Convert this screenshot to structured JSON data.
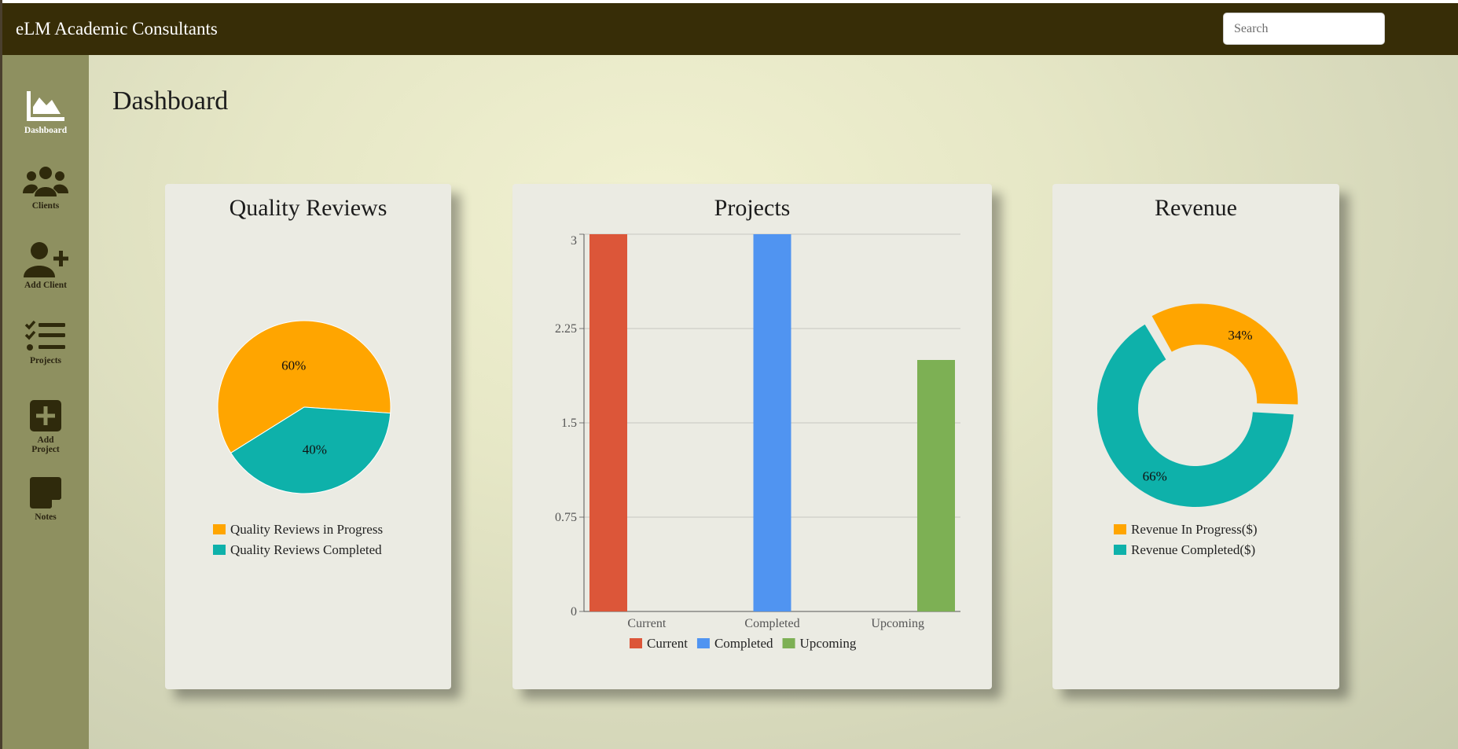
{
  "app": {
    "title": "eLM Academic Consultants"
  },
  "search": {
    "placeholder": "Search",
    "value": ""
  },
  "sidebar": {
    "items": [
      {
        "label": "Dashboard",
        "icon": "chart-area-icon",
        "active": true
      },
      {
        "label": "Clients",
        "icon": "users-icon",
        "active": false
      },
      {
        "label": "Add Client",
        "icon": "user-plus-icon",
        "active": false
      },
      {
        "label": "Projects",
        "icon": "task-list-icon",
        "active": false
      },
      {
        "label": "Add Project",
        "icon": "plus-square-icon",
        "active": false
      },
      {
        "label": "Notes",
        "icon": "sticky-note-icon",
        "active": false
      }
    ]
  },
  "page": {
    "title": "Dashboard"
  },
  "colors": {
    "header": "#372d07",
    "sidebar": "#8e9060",
    "orange": "#ffa500",
    "teal": "#0eb1aa",
    "red": "#dc5639",
    "blue": "#5094f1",
    "green": "#7db054"
  },
  "cards": {
    "quality": {
      "title": "Quality Reviews",
      "legend": [
        "Quality Reviews in Progress",
        "Quality Reviews Completed"
      ]
    },
    "projects": {
      "title": "Projects"
    },
    "revenue": {
      "title": "Revenue",
      "legend": [
        "Revenue In Progress($)",
        "Revenue Completed($)"
      ]
    }
  },
  "chart_data": [
    {
      "type": "pie",
      "title": "Quality Reviews",
      "categories": [
        "Quality Reviews in Progress",
        "Quality Reviews Completed"
      ],
      "values": [
        60,
        40
      ],
      "labels": [
        "60%",
        "40%"
      ],
      "colors": [
        "#ffa500",
        "#0eb1aa"
      ],
      "legend_position": "bottom"
    },
    {
      "type": "bar",
      "title": "Projects",
      "categories": [
        "Current",
        "Completed",
        "Upcoming"
      ],
      "series": [
        {
          "name": "Current",
          "values": [
            3,
            0,
            0
          ],
          "color": "#dc5639"
        },
        {
          "name": "Completed",
          "values": [
            0,
            3,
            0
          ],
          "color": "#5094f1"
        },
        {
          "name": "Upcoming",
          "values": [
            0,
            0,
            2
          ],
          "color": "#7db054"
        }
      ],
      "yticks": [
        "0",
        "0.75",
        "1.5",
        "2.25",
        "3"
      ],
      "ylim": [
        0,
        3
      ],
      "grid": true,
      "legend_position": "bottom"
    },
    {
      "type": "pie",
      "subtype": "donut",
      "title": "Revenue",
      "categories": [
        "Revenue In Progress($)",
        "Revenue Completed($)"
      ],
      "values": [
        34,
        66
      ],
      "labels": [
        "34%",
        "66%"
      ],
      "colors": [
        "#ffa500",
        "#0eb1aa"
      ],
      "legend_position": "bottom"
    }
  ]
}
